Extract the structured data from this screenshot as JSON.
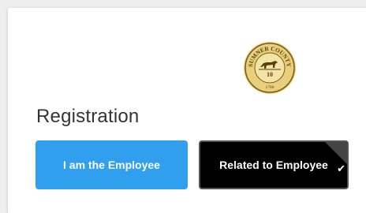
{
  "seal": {
    "top_text": "SUMNER COUNTY",
    "center_text": "10",
    "bottom_text": "1786"
  },
  "registration": {
    "heading": "Registration",
    "options": [
      {
        "label": "I am the Employee",
        "selected": false,
        "color": "#2f9fee"
      },
      {
        "label": "Related to Employee",
        "selected": true,
        "color": "#000000"
      }
    ]
  },
  "icons": {
    "selected_indicator": "checkmark-icon"
  },
  "colors": {
    "primary": "#2f9fee",
    "selected_background": "#000000",
    "page_background": "#eeeeee",
    "card_background": "#ffffff"
  }
}
